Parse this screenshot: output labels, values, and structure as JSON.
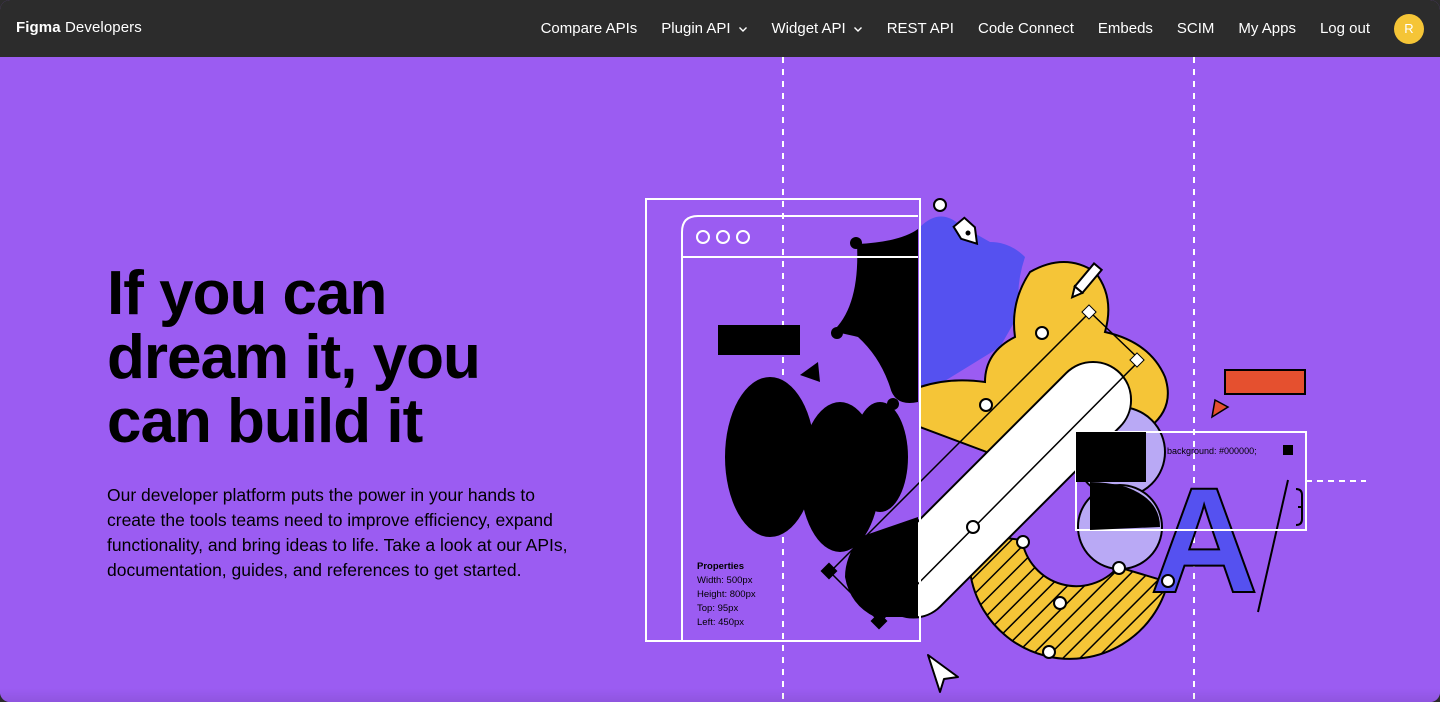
{
  "nav": {
    "brand_bold": "Figma",
    "brand_light": "Developers",
    "items": [
      {
        "label": "Compare APIs",
        "dropdown": false
      },
      {
        "label": "Plugin API",
        "dropdown": true
      },
      {
        "label": "Widget API",
        "dropdown": true
      },
      {
        "label": "REST API",
        "dropdown": false
      },
      {
        "label": "Code Connect",
        "dropdown": false
      },
      {
        "label": "Embeds",
        "dropdown": false
      },
      {
        "label": "SCIM",
        "dropdown": false
      },
      {
        "label": "My Apps",
        "dropdown": false
      },
      {
        "label": "Log out",
        "dropdown": false
      }
    ],
    "avatar_initial": "R"
  },
  "hero": {
    "headline_line1": "If you can",
    "headline_line2": "dream it, you",
    "headline_line3": "can build it",
    "body": "Our developer platform puts the power in your hands to create the tools teams need to improve efficiency, expand functionality, and bring ideas to life. Take a look at our APIs, documentation, guides, and references to get started."
  },
  "illustration": {
    "properties_title": "Properties",
    "properties": [
      "Width: 500px",
      "Height: 800px",
      "Top: 95px",
      "Left: 450px"
    ],
    "background_label": "background: #000000;",
    "letter": "A"
  },
  "colors": {
    "hero_bg": "#9b5cf2",
    "nav_bg": "#2c2c2c",
    "avatar": "#f5c537",
    "blue": "#5551f0",
    "yellow": "#f5c537",
    "orange_red": "#e5502f",
    "lavender": "#b9a9f5"
  }
}
